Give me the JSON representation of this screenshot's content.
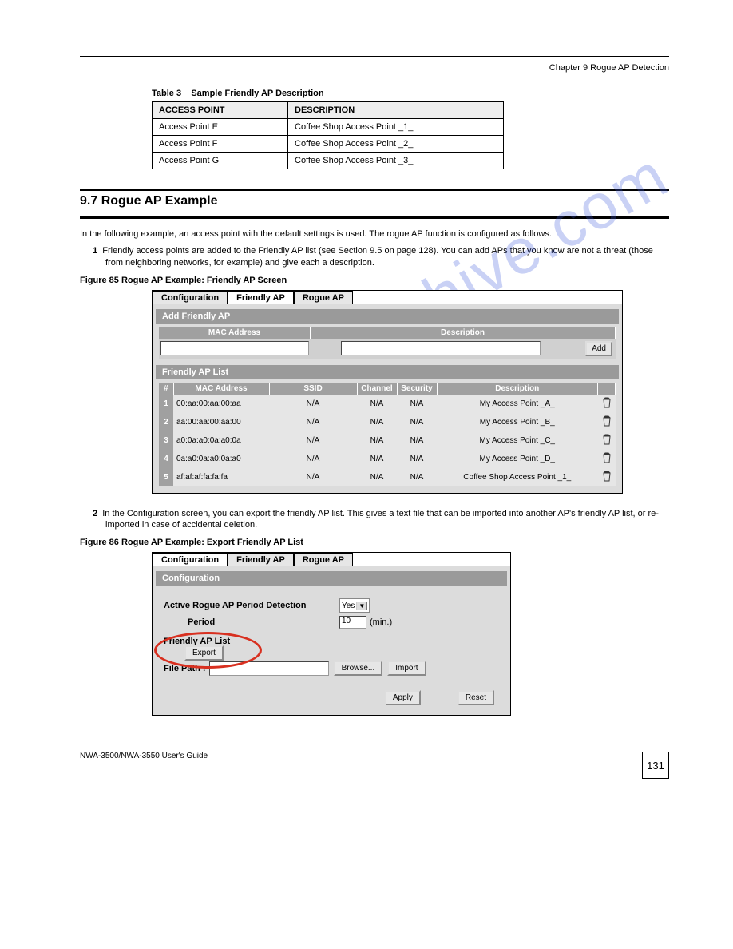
{
  "header": {
    "chapter": "Chapter 9 Rogue AP Detection"
  },
  "table1": {
    "caption": "Table 3",
    "caption_cont": "Sample Friendly AP Description",
    "col1_header": "ACCESS POINT",
    "col2_header": "DESCRIPTION",
    "rows": [
      {
        "ap": "Access Point E",
        "desc": "Coffee Shop Access Point _1_"
      },
      {
        "ap": "Access Point F",
        "desc": "Coffee Shop Access Point _2_"
      },
      {
        "ap": "Access Point G",
        "desc": "Coffee Shop Access Point _3_"
      }
    ]
  },
  "heading": "9.7  Rogue AP Example",
  "intro_text": "In the following example, an access point with the default settings is used. The rogue AP function is configured as follows.",
  "step1_num": "1",
  "step1_text": "Friendly access points are added to the Friendly AP list (see Section 9.5 on page 128). You can add APs that you know are not a threat (those from neighboring networks, for example) and give each a description.",
  "fig85": {
    "caption": "Figure 85   Rogue AP Example: Friendly AP Screen"
  },
  "panel1": {
    "tabs": [
      "Configuration",
      "Friendly AP",
      "Rogue AP"
    ],
    "add_section": "Add Friendly AP",
    "add_header": {
      "mac": "MAC Address",
      "desc": "Description"
    },
    "add_btn": "Add",
    "list_section": "Friendly AP List",
    "list_headers": {
      "idx": "#",
      "mac": "MAC Address",
      "ssid": "SSID",
      "chan": "Channel",
      "sec": "Security",
      "desc": "Description"
    },
    "rows": [
      {
        "idx": "1",
        "mac": "00:aa:00:aa:00:aa",
        "ssid": "N/A",
        "chan": "N/A",
        "sec": "N/A",
        "desc": "My Access Point _A_"
      },
      {
        "idx": "2",
        "mac": "aa:00:aa:00:aa:00",
        "ssid": "N/A",
        "chan": "N/A",
        "sec": "N/A",
        "desc": "My Access Point _B_"
      },
      {
        "idx": "3",
        "mac": "a0:0a:a0:0a:a0:0a",
        "ssid": "N/A",
        "chan": "N/A",
        "sec": "N/A",
        "desc": "My Access Point _C_"
      },
      {
        "idx": "4",
        "mac": "0a:a0:0a:a0:0a:a0",
        "ssid": "N/A",
        "chan": "N/A",
        "sec": "N/A",
        "desc": "My Access Point _D_"
      },
      {
        "idx": "5",
        "mac": "af:af:af:fa:fa:fa",
        "ssid": "N/A",
        "chan": "N/A",
        "sec": "N/A",
        "desc": "Coffee Shop Access Point _1_"
      }
    ]
  },
  "step2_num": "2",
  "step2_text": "In the Configuration screen, you can export the friendly AP list. This gives a text file that can be imported into another AP's friendly AP list, or re-imported in case of accidental deletion.",
  "fig86": {
    "caption": "Figure 86   Rogue AP Example: Export Friendly AP List"
  },
  "panel2": {
    "tabs": [
      "Configuration",
      "Friendly AP",
      "Rogue AP"
    ],
    "section": "Configuration",
    "active_label": "Active Rogue AP Period Detection",
    "period_label": "Period",
    "select_value": "Yes",
    "period_value": "10",
    "period_unit": "(min.)",
    "friendly_list_label": "Friendly AP List",
    "export_btn": "Export",
    "file_path_label": "File Path :",
    "browse_btn": "Browse...",
    "import_btn": "Import",
    "apply_btn": "Apply",
    "reset_btn": "Reset"
  },
  "footer": {
    "manual": "NWA-3500/NWA-3550 User's Guide",
    "page": "131"
  },
  "watermark": "manualshive.com"
}
